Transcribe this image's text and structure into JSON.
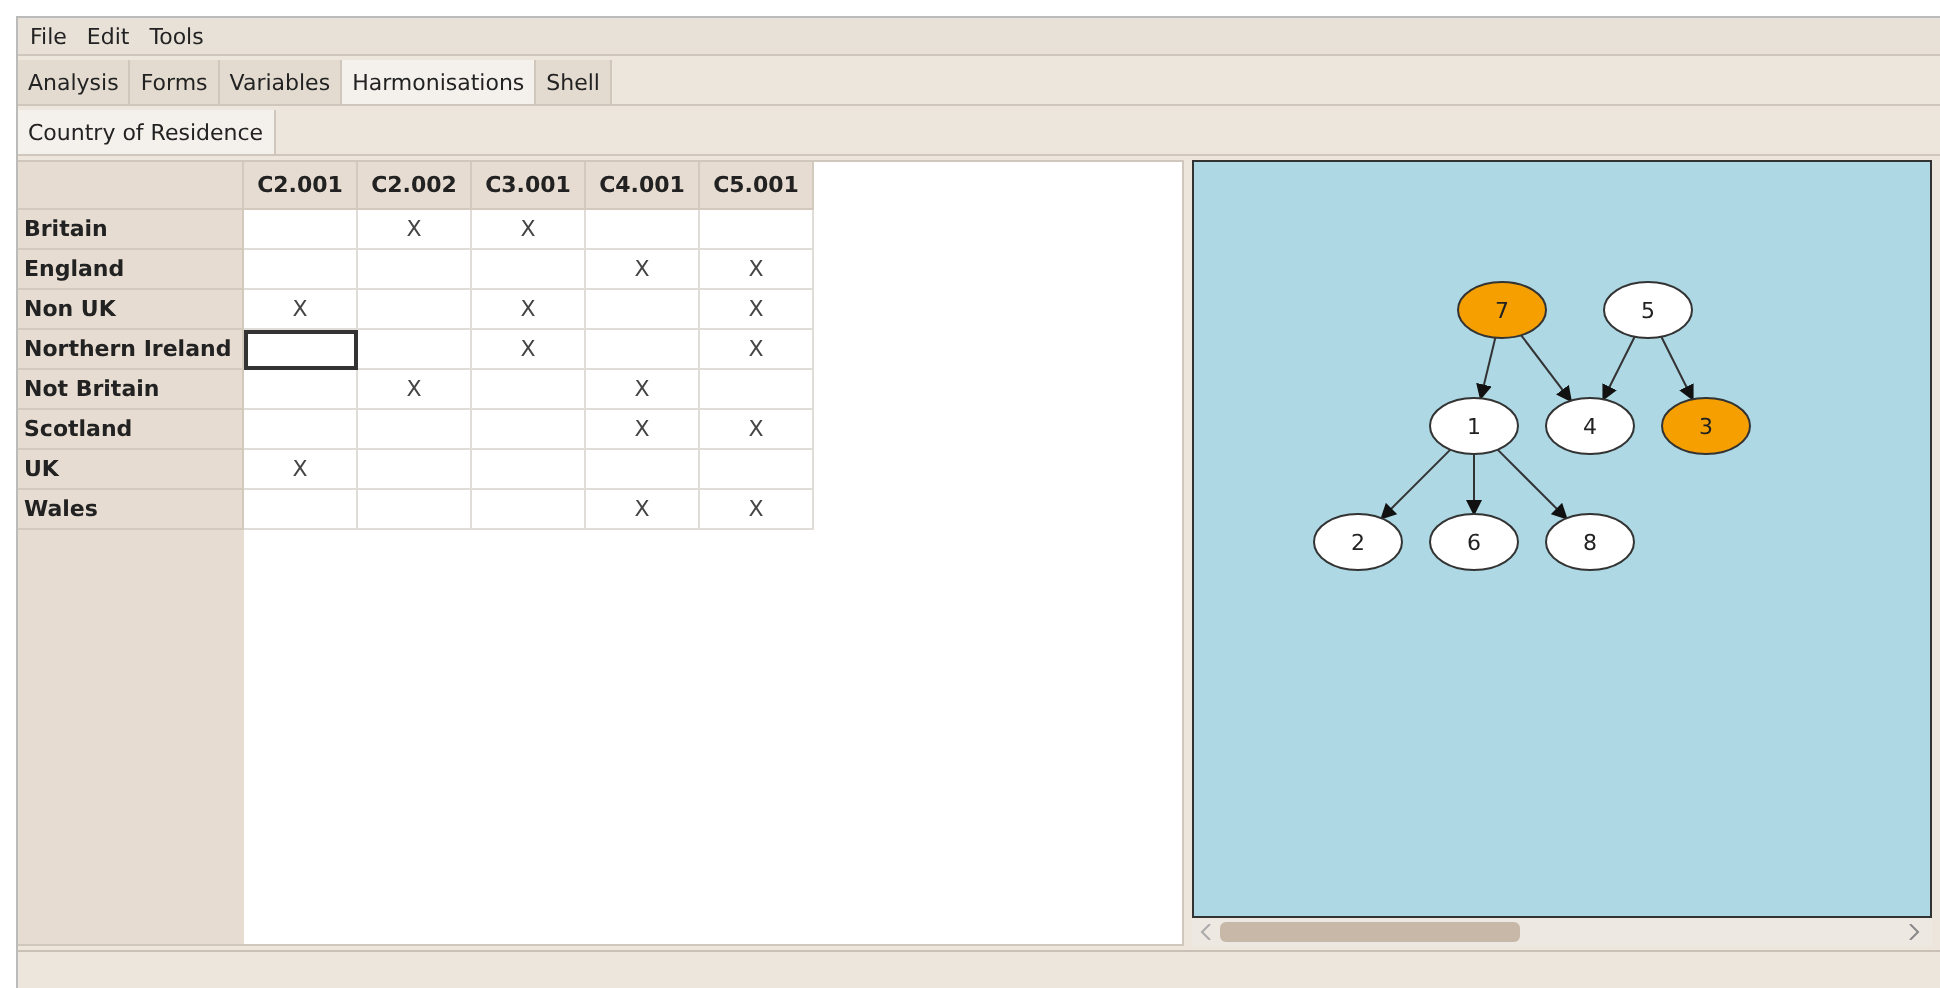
{
  "menu": [
    "File",
    "Edit",
    "Tools"
  ],
  "tabs": [
    {
      "label": "Analysis",
      "selected": false
    },
    {
      "label": "Forms",
      "selected": false
    },
    {
      "label": "Variables",
      "selected": false
    },
    {
      "label": "Harmonisations",
      "selected": true
    },
    {
      "label": "Shell",
      "selected": false
    }
  ],
  "subtabs": [
    {
      "label": "Country of Residence",
      "selected": true
    }
  ],
  "table": {
    "columns": [
      "C2.001",
      "C2.002",
      "C3.001",
      "C4.001",
      "C5.001"
    ],
    "rows": [
      {
        "header": "Britain",
        "cells": [
          {
            "selected": false
          },
          {
            "text": "X",
            "selected": false
          },
          {
            "text": "X",
            "selected": false
          },
          {
            "selected": false
          },
          {
            "selected": false
          }
        ]
      },
      {
        "header": "England",
        "cells": [
          {
            "selected": false
          },
          {
            "selected": false
          },
          {
            "selected": false
          },
          {
            "text": "X",
            "selected": false
          },
          {
            "text": "X",
            "selected": false
          }
        ]
      },
      {
        "header": "Non UK",
        "cells": [
          {
            "text": "X",
            "selected": false
          },
          {
            "selected": false
          },
          {
            "text": "X",
            "selected": false
          },
          {
            "selected": false
          },
          {
            "text": "X",
            "selected": false
          }
        ]
      },
      {
        "header": "Northern Ireland",
        "cells": [
          {
            "selected": true
          },
          {
            "selected": false
          },
          {
            "text": "X",
            "selected": false
          },
          {
            "selected": false
          },
          {
            "text": "X",
            "selected": false
          }
        ]
      },
      {
        "header": "Not Britain",
        "cells": [
          {
            "selected": false
          },
          {
            "text": "X",
            "selected": false
          },
          {
            "selected": false
          },
          {
            "text": "X",
            "selected": false
          },
          {
            "selected": false
          }
        ]
      },
      {
        "header": "Scotland",
        "cells": [
          {
            "selected": false
          },
          {
            "selected": false
          },
          {
            "selected": false
          },
          {
            "text": "X",
            "selected": false
          },
          {
            "text": "X",
            "selected": false
          }
        ]
      },
      {
        "header": "UK",
        "cells": [
          {
            "text": "X",
            "selected": false
          },
          {
            "selected": false
          },
          {
            "selected": false
          },
          {
            "selected": false
          },
          {
            "selected": false
          }
        ]
      },
      {
        "header": "Wales",
        "cells": [
          {
            "selected": false
          },
          {
            "selected": false
          },
          {
            "selected": false
          },
          {
            "text": "X",
            "selected": false
          },
          {
            "text": "X",
            "selected": false
          }
        ]
      }
    ]
  },
  "graph": {
    "nodes": [
      {
        "label": "7",
        "highlighted": true
      },
      {
        "label": "5",
        "highlighted": false
      },
      {
        "label": "1",
        "highlighted": false
      },
      {
        "label": "4",
        "highlighted": false
      },
      {
        "label": "3",
        "highlighted": true
      },
      {
        "label": "2",
        "highlighted": false
      },
      {
        "label": "6",
        "highlighted": false
      },
      {
        "label": "8",
        "highlighted": false
      }
    ]
  }
}
